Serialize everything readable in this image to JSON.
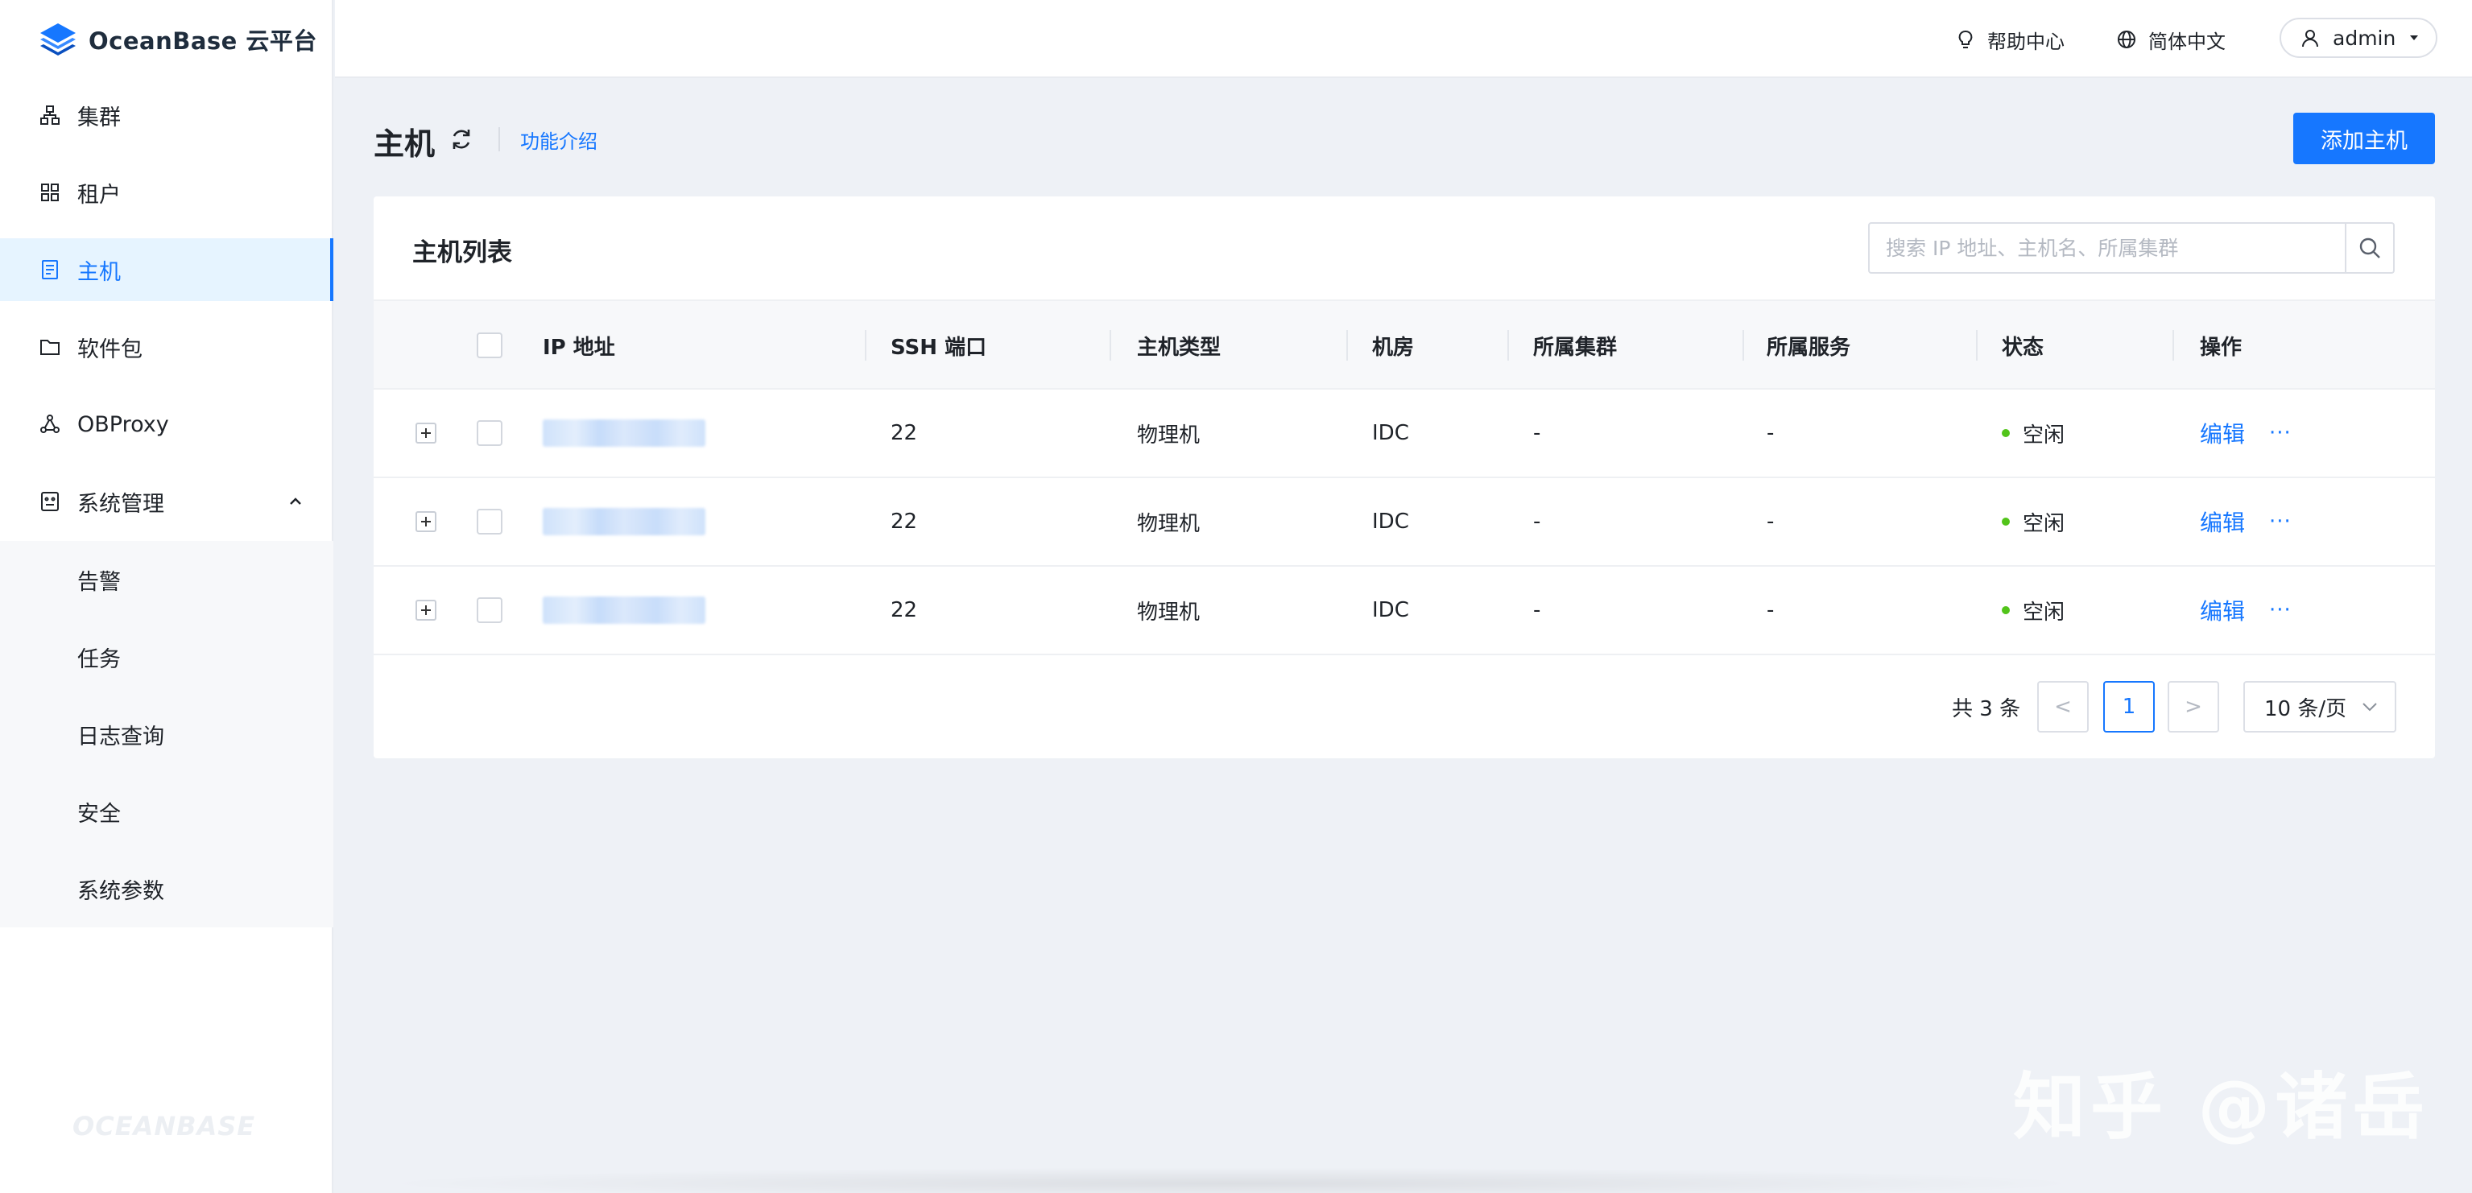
{
  "brand": {
    "name": "OceanBase 云平台",
    "watermark": "OCEANBASE"
  },
  "sidebar": {
    "items": [
      {
        "label": "集群",
        "icon": "cluster-icon"
      },
      {
        "label": "租户",
        "icon": "tenant-icon"
      },
      {
        "label": "主机",
        "icon": "host-icon",
        "active": true
      },
      {
        "label": "软件包",
        "icon": "folder-icon"
      },
      {
        "label": "OBProxy",
        "icon": "proxy-icon"
      },
      {
        "label": "系统管理",
        "icon": "system-icon",
        "expanded": true
      }
    ],
    "submenu": [
      {
        "label": "告警"
      },
      {
        "label": "任务"
      },
      {
        "label": "日志查询"
      },
      {
        "label": "安全"
      },
      {
        "label": "系统参数"
      }
    ]
  },
  "header": {
    "help": "帮助中心",
    "language": "简体中文",
    "user": "admin"
  },
  "page": {
    "title": "主机",
    "intro_link": "功能介绍",
    "add_button": "添加主机"
  },
  "card": {
    "title": "主机列表",
    "search_placeholder": "搜索 IP 地址、主机名、所属集群"
  },
  "table": {
    "columns": [
      "IP 地址",
      "SSH 端口",
      "主机类型",
      "机房",
      "所属集群",
      "所属服务",
      "状态",
      "操作"
    ],
    "rows": [
      {
        "ssh_port": "22",
        "type": "物理机",
        "idc": "IDC",
        "cluster": "-",
        "service": "-",
        "status": "空闲",
        "action": "编辑",
        "more": "···"
      },
      {
        "ssh_port": "22",
        "type": "物理机",
        "idc": "IDC",
        "cluster": "-",
        "service": "-",
        "status": "空闲",
        "action": "编辑",
        "more": "···"
      },
      {
        "ssh_port": "22",
        "type": "物理机",
        "idc": "IDC",
        "cluster": "-",
        "service": "-",
        "status": "空闲",
        "action": "编辑",
        "more": "···"
      }
    ]
  },
  "pagination": {
    "total": "共 3 条",
    "prev": "<",
    "current": "1",
    "next": ">",
    "page_size": "10 条/页"
  },
  "colors": {
    "primary": "#1677ff",
    "status_idle": "#52c41a"
  },
  "watermark_text": "知乎 @诸岳"
}
